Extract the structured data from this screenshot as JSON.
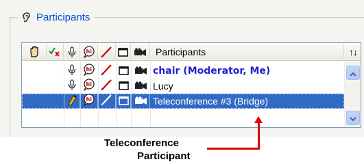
{
  "groupbox": {
    "title": "Participants"
  },
  "table": {
    "header": {
      "columns": [
        {
          "icon": "raise-hand-icon"
        },
        {
          "icon": "check-x-icon"
        },
        {
          "icon": "microphone-icon"
        },
        {
          "icon": "chat-hi-icon"
        },
        {
          "icon": "pen-icon"
        },
        {
          "icon": "window-icon"
        },
        {
          "icon": "camera-icon"
        }
      ],
      "participants_label": "Participants",
      "sort_label": "↑↓"
    },
    "rows": [
      {
        "name": "chair (Moderator, Me)",
        "selected": false,
        "icons": [
          "microphone-icon",
          "chat-hi-icon",
          "pen-icon",
          "window-icon",
          "camera-icon"
        ]
      },
      {
        "name": "Lucy",
        "selected": false,
        "icons": [
          "microphone-icon",
          "chat-hi-icon",
          "pen-icon",
          "window-icon",
          "camera-icon"
        ]
      },
      {
        "name": "Teleconference #3 (Bridge)",
        "selected": true,
        "icons": [
          "microphone-icon",
          "chat-hi-icon",
          "pen-icon",
          "window-icon",
          "camera-icon"
        ]
      }
    ]
  },
  "callout": {
    "line1": "Teleconference",
    "line2": "Participant",
    "color": "#e00000"
  },
  "colors": {
    "selection": "#316ac5",
    "moderator_text": "#2222cc",
    "title_text": "#0046d5"
  }
}
